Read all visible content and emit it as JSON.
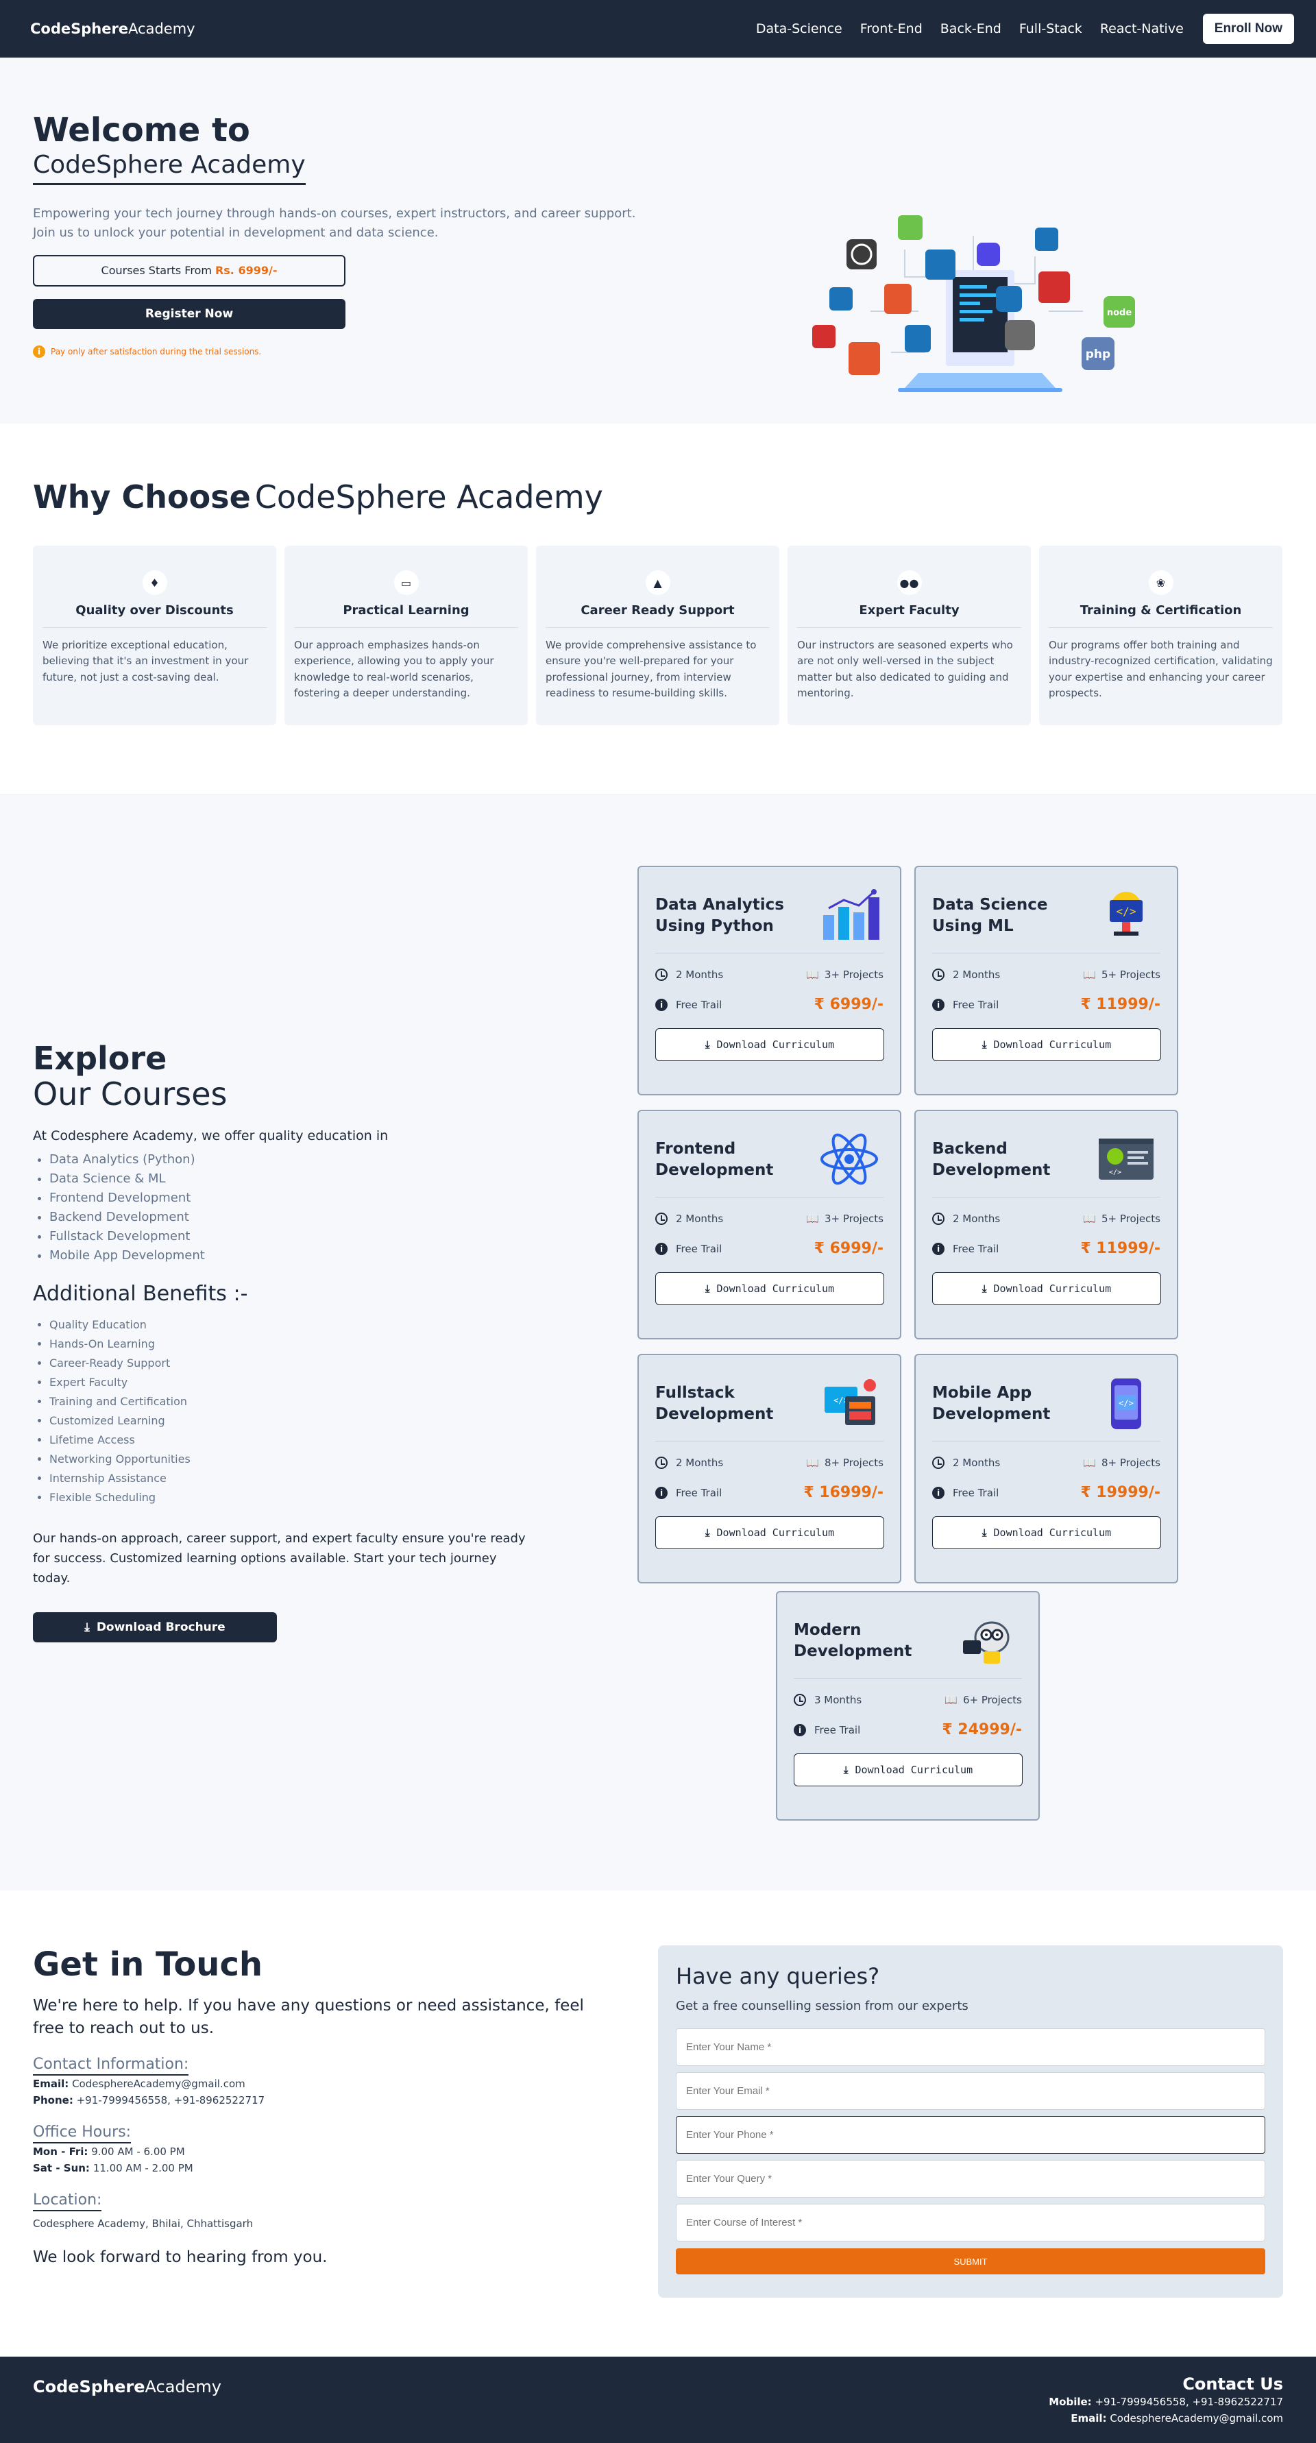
{
  "nav": {
    "brand_bold": "CodeSphere",
    "brand_light": "Academy",
    "links": [
      "Data-Science",
      "Front-End",
      "Back-End",
      "Full-Stack",
      "React-Native"
    ],
    "enroll_label": "Enroll Now"
  },
  "hero": {
    "title": "Welcome to",
    "subtitle": "CodeSphere Academy",
    "description": "Empowering your tech journey through hands-on courses, expert instructors, and career support. Join us to unlock your potential in development and data science.",
    "price_prefix": "Courses Starts From",
    "price_amount": "Rs. 6999/-",
    "register_label": "Register Now",
    "note": "Pay only after satisfaction during the trial sessions.",
    "note_icon": "info-icon",
    "art_colors": {
      "orange": "#e4572e",
      "blue": "#1d73b8",
      "purple": "#4f46e5",
      "green": "#6cc24a",
      "red": "#d32f2f",
      "php": "#6181b6",
      "dark": "#3b3b3b"
    }
  },
  "why": {
    "title_bold": "Why Choose",
    "title_light": "CodeSphere Academy",
    "features": [
      {
        "title": "Quality over Discounts",
        "icon": "tag-icon",
        "text": "We prioritize exceptional education, believing that it's an investment in your future, not just a cost-saving deal."
      },
      {
        "title": "Practical Learning",
        "icon": "laptop-icon",
        "text": "Our approach emphasizes hands-on experience, allowing you to apply your knowledge to real-world scenarios, fostering a deeper understanding."
      },
      {
        "title": "Career Ready Support",
        "icon": "graduation-cap-icon",
        "text": "We provide comprehensive assistance to ensure you're well-prepared for your professional journey, from interview readiness to resume-building skills."
      },
      {
        "title": "Expert Faculty",
        "icon": "users-icon",
        "text": "Our instructors are seasoned experts who are not only well-versed in the subject matter but also dedicated to guiding and mentoring."
      },
      {
        "title": "Training & Certification",
        "icon": "award-icon",
        "text": "Our programs offer both training and industry-recognized certification, validating your expertise and enhancing your career prospects."
      }
    ]
  },
  "courses": {
    "title": "Explore",
    "subtitle": "Our Courses",
    "intro": "At Codesphere Academy, we offer quality education in",
    "list": [
      "Data Analytics (Python)",
      "Data Science & ML",
      "Frontend Development",
      "Backend Development",
      "Fullstack Development",
      "Mobile App Development"
    ],
    "benefits_title": "Additional Benefits :-",
    "benefits": [
      "Quality Education",
      "Hands-On Learning",
      "Career-Ready Support",
      "Expert Faculty",
      "Training and Certification",
      "Customized Learning",
      "Lifetime Access",
      "Networking Opportunities",
      "Internship Assistance",
      "Flexible Scheduling"
    ],
    "closing": "Our hands-on approach, career support, and expert faculty ensure you're ready for success. Customized learning options available. Start your tech journey today.",
    "brochure_label": "Download Brochure",
    "download_label": "Download Curriculum",
    "trial_label": "Free Trail",
    "cards": [
      {
        "title": "Data Analytics Using Python",
        "duration": "2 Months",
        "projects": "3+ Projects",
        "price": "₹ 6999/-",
        "icon": "bar-chart-icon"
      },
      {
        "title": "Data Science Using ML",
        "duration": "2 Months",
        "projects": "5+ Projects",
        "price": "₹ 11999/-",
        "icon": "code-monitor-icon"
      },
      {
        "title": "Frontend Development",
        "duration": "2 Months",
        "projects": "3+ Projects",
        "price": "₹ 6999/-",
        "icon": "react-icon"
      },
      {
        "title": "Backend Development",
        "duration": "2 Months",
        "projects": "5+ Projects",
        "price": "₹ 11999/-",
        "icon": "server-code-icon"
      },
      {
        "title": "Fullstack Development",
        "duration": "2 Months",
        "projects": "8+ Projects",
        "price": "₹ 16999/-",
        "icon": "web-design-icon"
      },
      {
        "title": "Mobile App Development",
        "duration": "2 Months",
        "projects": "8+ Projects",
        "price": "₹ 19999/-",
        "icon": "mobile-code-icon"
      },
      {
        "title": "Modern Development",
        "duration": "3 Months",
        "projects": "6+ Projects",
        "price": "₹ 24999/-",
        "icon": "robot-icon"
      }
    ]
  },
  "contact": {
    "title": "Get in Touch",
    "lead": "We're here to help. If you have any questions or need assistance, feel free to reach out to us.",
    "contact_head": "Contact Information:",
    "email_label": "Email:",
    "email": "CodesphereAcademy@gmail.com",
    "phone_label": "Phone:",
    "phone": "+91-7999456558, +91-8962522717",
    "hours_head": "Office Hours:",
    "weekday_label": "Mon - Fri:",
    "weekday_hours": "9.00 AM - 6.00 PM",
    "weekend_label": "Sat - Sun:",
    "weekend_hours": "11.00 AM - 2.00 PM",
    "location_head": "Location:",
    "location": "Codesphere Academy, Bhilai, Chhattisgarh",
    "closing": "We look forward to hearing from you.",
    "form": {
      "title": "Have any queries?",
      "subtitle": "Get a free counselling session from our experts",
      "name_placeholder": "Enter Your Name *",
      "email_placeholder": "Enter Your Email *",
      "phone_placeholder": "Enter Your Phone *",
      "query_placeholder": "Enter Your Query *",
      "course_placeholder": "Enter Course of Interest *",
      "submit_label": "SUBMIT"
    }
  },
  "footer": {
    "brand_bold": "CodeSphere",
    "brand_light": "Academy",
    "title": "Contact Us",
    "mobile_label": "Mobile:",
    "mobile": "+91-7999456558, +91-8962522717",
    "email_label": "Email:",
    "email": "CodesphereAcademy@gmail.com"
  },
  "colors": {
    "navy": "#1e293b",
    "accent": "#ea6c10",
    "card_bg": "#e2e8f0",
    "light_bg": "#f6f8fb"
  }
}
